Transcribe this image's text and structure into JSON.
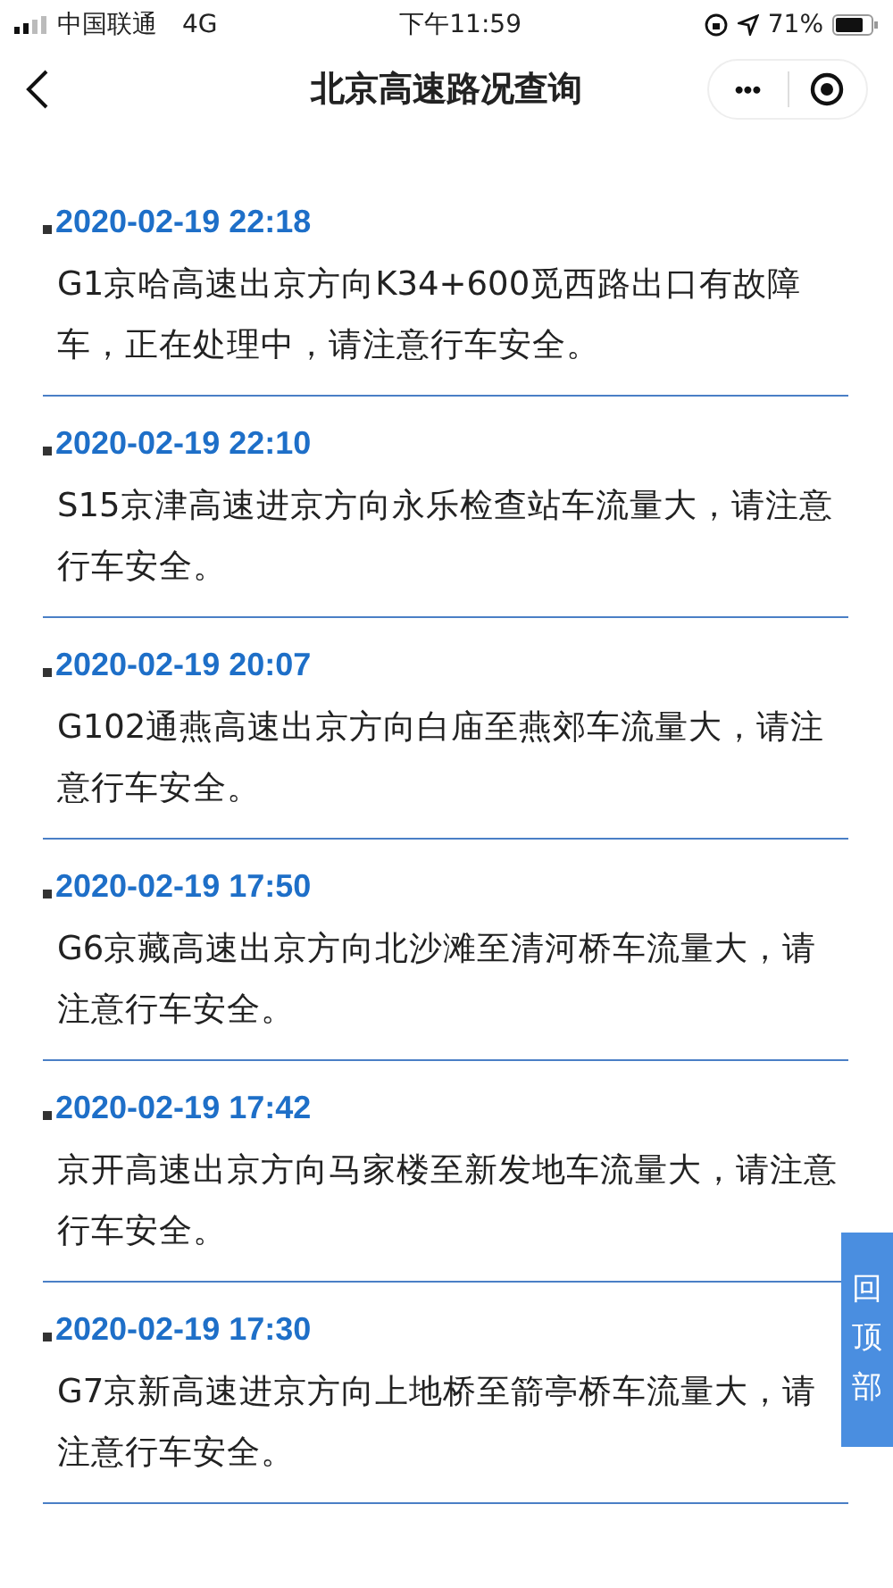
{
  "status_bar": {
    "carrier": "中国联通",
    "network": "4G",
    "time": "下午11:59",
    "battery": "71%"
  },
  "nav": {
    "title": "北京高速路况查询",
    "more": "•••"
  },
  "reports": [
    {
      "time": "2020-02-19 22:18",
      "text": "G1京哈高速出京方向K34+600觅西路出口有故障车，正在处理中，请注意行车安全。"
    },
    {
      "time": "2020-02-19 22:10",
      "text": "S15京津高速进京方向永乐检查站车流量大，请注意行车安全。"
    },
    {
      "time": "2020-02-19 20:07",
      "text": "G102通燕高速出京方向白庙至燕郊车流量大，请注意行车安全。"
    },
    {
      "time": "2020-02-19 17:50",
      "text": "G6京藏高速出京方向北沙滩至清河桥车流量大，请注意行车安全。"
    },
    {
      "time": "2020-02-19 17:42",
      "text": "京开高速出京方向马家楼至新发地车流量大，请注意行车安全。"
    },
    {
      "time": "2020-02-19 17:30",
      "text": "G7京新高速进京方向上地桥至箭亭桥车流量大，请注意行车安全。"
    }
  ],
  "back_to_top": "回顶部"
}
